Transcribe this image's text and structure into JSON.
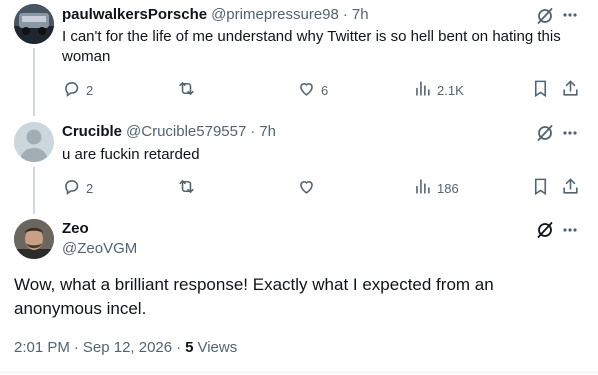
{
  "reply1": {
    "name": "paulwalkersPorsche",
    "handle": "@primepressure98",
    "time": "7h",
    "text": "I can't for the life of me understand why Twitter is so hell bent on hating this woman",
    "replies": "2",
    "retweets": "",
    "likes": "6",
    "views": "2.1K"
  },
  "reply2": {
    "name": "Crucible",
    "handle": "@Crucible579557",
    "time": "7h",
    "text": "u are fuckin retarded",
    "replies": "2",
    "retweets": "",
    "likes": "",
    "views": "186"
  },
  "main": {
    "name": "Zeo",
    "handle": "@ZeoVGM",
    "text": "Wow, what a brilliant response! Exactly what I expected from an anonymous incel.",
    "time": "2:01 PM",
    "date": "Sep 12, 2026",
    "views_count": "5",
    "views_label": "Views"
  },
  "separator": "·",
  "colors": {
    "text": "#0f1419",
    "muted": "#536471",
    "line": "#cfd9de"
  },
  "icons": [
    "grok-icon",
    "more-icon",
    "reply-icon",
    "retweet-icon",
    "like-icon",
    "views-icon",
    "bookmark-icon",
    "share-icon"
  ]
}
